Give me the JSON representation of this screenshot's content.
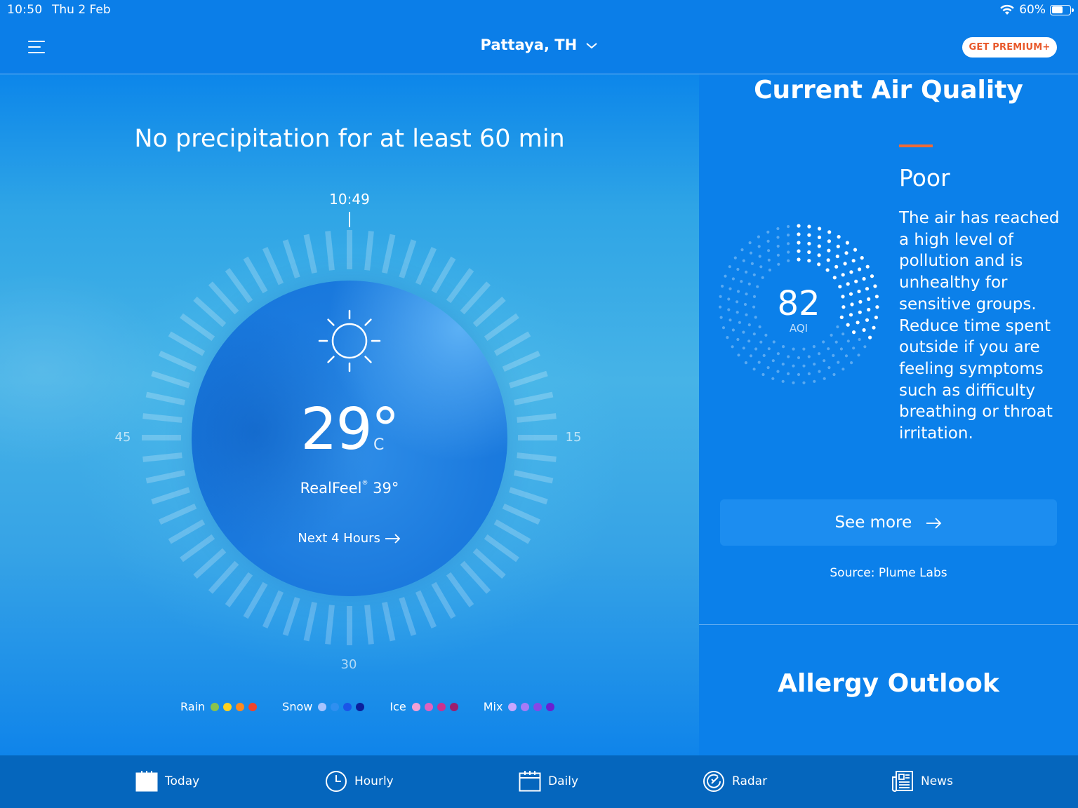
{
  "status_bar": {
    "time": "10:50",
    "date": "Thu 2 Feb",
    "battery": "60%",
    "battery_level": 0.6
  },
  "header": {
    "location": "Pattaya, TH",
    "premium_label": "GET PREMIUM+",
    "premium_color": "#e8582a"
  },
  "minutecast": {
    "message": "No precipitation for at least 60 min",
    "current_time": "10:49",
    "dial_labels": {
      "right": "15",
      "bottom": "30",
      "left": "45"
    },
    "condition_icon": "sun-icon",
    "temperature": "29°",
    "unit": "C",
    "realfeel_label": "RealFeel",
    "realfeel_mark": "®",
    "realfeel_value": "39°",
    "next_hours_label": "Next 4 Hours"
  },
  "legend": [
    {
      "label": "Rain",
      "colors": [
        "#8bc34a",
        "#ffd21f",
        "#ff8a1f",
        "#f0442b"
      ]
    },
    {
      "label": "Snow",
      "colors": [
        "#a7c4ff",
        "#2f8ff0",
        "#1a55e8",
        "#0b1f9c"
      ]
    },
    {
      "label": "Ice",
      "colors": [
        "#f3a0d6",
        "#e062bf",
        "#c9318f",
        "#9c1e6f"
      ]
    },
    {
      "label": "Mix",
      "colors": [
        "#c7a6ff",
        "#a57bf7",
        "#8747e6",
        "#6a1fd1"
      ]
    }
  ],
  "air_quality": {
    "title": "Current Air Quality",
    "level": "Poor",
    "level_color": "#f06a35",
    "description": "The air has reached a high level of pollution and is unhealthy for sensitive groups. Reduce time spent outside if you are feeling symptoms such as difficulty breathing or throat irritation.",
    "aqi_value": "82",
    "aqi_label": "AQI",
    "see_more_label": "See more",
    "source": "Source: Plume Labs"
  },
  "allergy": {
    "title": "Allergy Outlook"
  },
  "tabs": [
    {
      "label": "Today",
      "icon": "calendar-today-icon"
    },
    {
      "label": "Hourly",
      "icon": "clock-icon"
    },
    {
      "label": "Daily",
      "icon": "calendar-icon"
    },
    {
      "label": "Radar",
      "icon": "radar-icon"
    },
    {
      "label": "News",
      "icon": "newspaper-icon"
    }
  ]
}
